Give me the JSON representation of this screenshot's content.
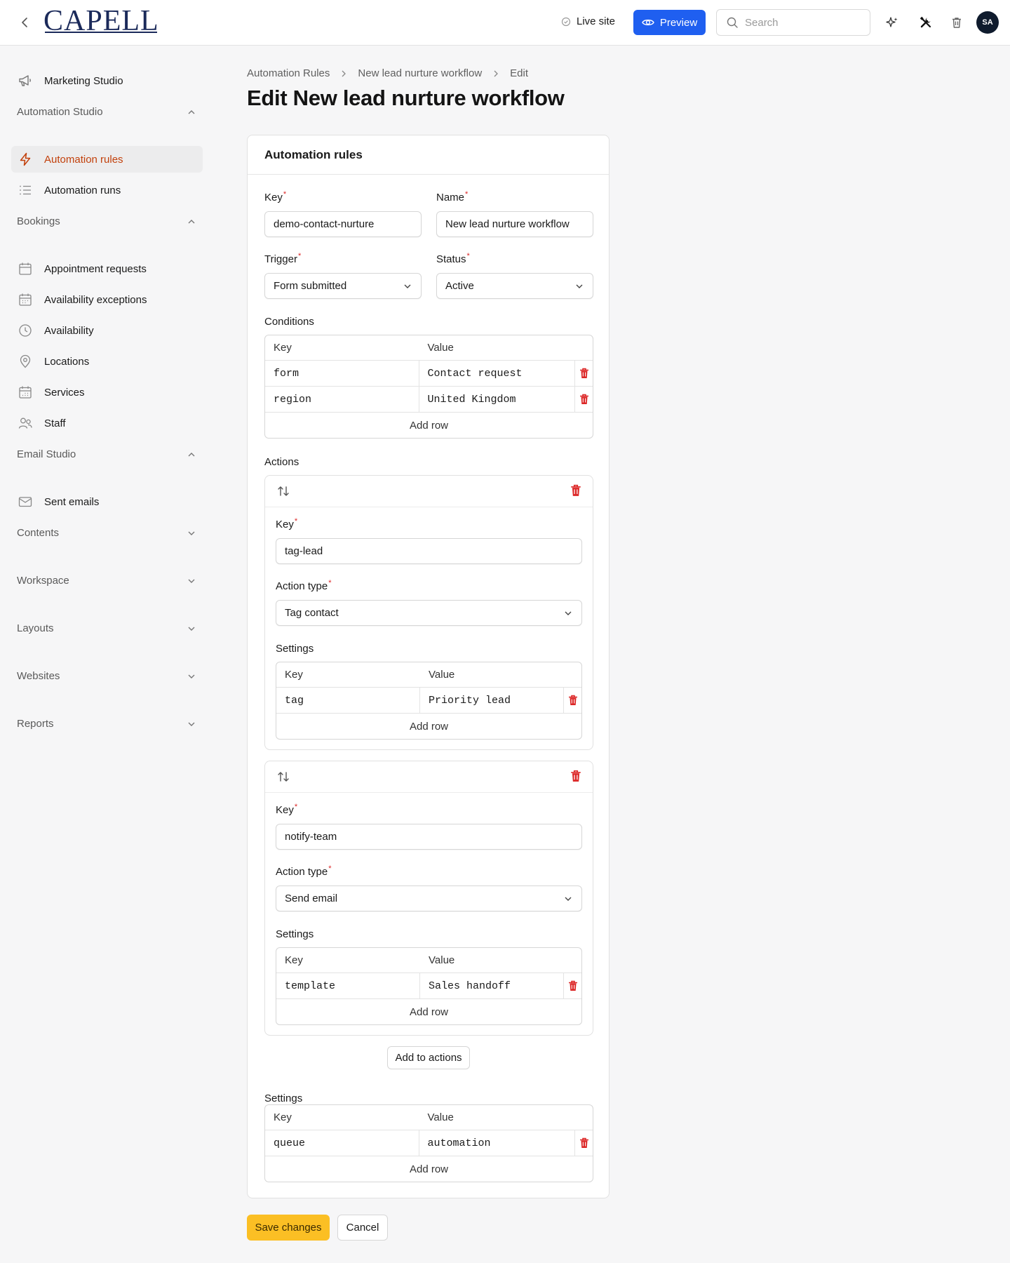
{
  "topbar": {
    "logo": "CAPELL",
    "live_site": "Live site",
    "preview": "Preview",
    "search_placeholder": "Search",
    "avatar": "SA",
    "icons": [
      "chevron-left-icon",
      "check-circle-icon",
      "eye-icon",
      "search-icon",
      "sparkles-icon",
      "tools-icon",
      "trash-icon"
    ]
  },
  "sidebar": {
    "top_item": "Marketing Studio",
    "sections": [
      {
        "label": "Automation Studio",
        "expanded": true,
        "items": [
          "Automation rules",
          "Automation runs"
        ]
      },
      {
        "label": "Bookings",
        "expanded": true,
        "items": [
          "Appointment requests",
          "Availability exceptions",
          "Availability",
          "Locations",
          "Services",
          "Staff"
        ]
      },
      {
        "label": "Email Studio",
        "expanded": true,
        "items": [
          "Sent emails"
        ]
      },
      {
        "label": "Contents",
        "expanded": false
      },
      {
        "label": "Workspace",
        "expanded": false
      },
      {
        "label": "Layouts",
        "expanded": false
      },
      {
        "label": "Websites",
        "expanded": false
      },
      {
        "label": "Reports",
        "expanded": false
      }
    ],
    "active_item": "Automation rules",
    "active_color": "#c2410c"
  },
  "breadcrumb": [
    "Automation Rules",
    "New lead nurture workflow",
    "Edit"
  ],
  "page_title": "Edit New lead nurture workflow",
  "form": {
    "card_title": "Automation rules",
    "key_label": "Key",
    "key_value": "demo-contact-nurture",
    "name_label": "Name",
    "name_value": "New lead nurture workflow",
    "trigger_label": "Trigger",
    "trigger_value": "Form submitted",
    "status_label": "Status",
    "status_value": "Active",
    "conditions_label": "Conditions",
    "kv_key_header": "Key",
    "kv_value_header": "Value",
    "add_row": "Add row",
    "conditions": [
      {
        "key": "form",
        "value": "Contact request"
      },
      {
        "key": "region",
        "value": "United Kingdom"
      }
    ],
    "actions_label": "Actions",
    "actions": [
      {
        "key_label": "Key",
        "key": "tag-lead",
        "type_label": "Action type",
        "type": "Tag contact",
        "settings_label": "Settings",
        "settings": [
          {
            "key": "tag",
            "value": "Priority lead"
          }
        ]
      },
      {
        "key_label": "Key",
        "key": "notify-team",
        "type_label": "Action type",
        "type": "Send email",
        "settings_label": "Settings",
        "settings": [
          {
            "key": "template",
            "value": "Sales handoff"
          }
        ]
      }
    ],
    "add_to_actions": "Add to actions",
    "settings_label": "Settings",
    "settings": [
      {
        "key": "queue",
        "value": "automation"
      }
    ]
  },
  "buttons": {
    "save": "Save changes",
    "cancel": "Cancel"
  },
  "colors": {
    "primary_blue": "#1f5ff0",
    "save_yellow": "#fbbf24",
    "delete_red": "#dc2626"
  }
}
